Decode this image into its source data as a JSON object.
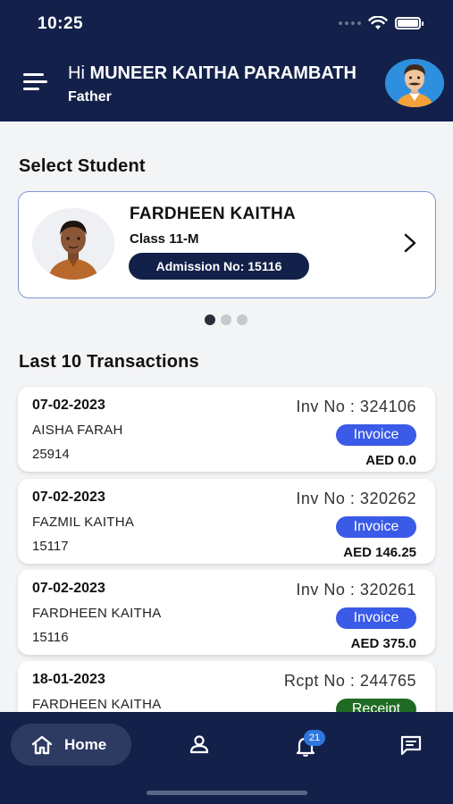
{
  "status_bar": {
    "time": "10:25"
  },
  "header": {
    "greeting_prefix": "Hi",
    "parent_name": "MUNEER KAITHA PARAMBATH",
    "role": "Father"
  },
  "select_student": {
    "title": "Select Student",
    "student": {
      "name": "FARDHEEN KAITHA",
      "class": "Class 11-M",
      "admission": "Admission No: 15116"
    },
    "pager": {
      "count": 3,
      "active": 0
    }
  },
  "transactions": {
    "title": "Last 10 Transactions",
    "items": [
      {
        "date": "07-02-2023",
        "name": "AISHA FARAH",
        "id": "25914",
        "ref": "Inv No : 324106",
        "type": "Invoice",
        "amount": "AED 0.0"
      },
      {
        "date": "07-02-2023",
        "name": "FAZMIL KAITHA",
        "id": "15117",
        "ref": "Inv No : 320262",
        "type": "Invoice",
        "amount": "AED 146.25"
      },
      {
        "date": "07-02-2023",
        "name": "FARDHEEN KAITHA",
        "id": "15116",
        "ref": "Inv No : 320261",
        "type": "Invoice",
        "amount": "AED 375.0"
      },
      {
        "date": "18-01-2023",
        "name": "FARDHEEN KAITHA",
        "id": "",
        "ref": "Rcpt No : 244765",
        "type": "Receipt",
        "amount": ""
      }
    ]
  },
  "bottom_nav": {
    "home_label": "Home",
    "notification_count": "21",
    "icons": [
      "home-icon",
      "profile-icon",
      "bell-icon",
      "chat-icon"
    ]
  },
  "colors": {
    "primary": "#13214a",
    "invoice": "#3a5ae8",
    "receipt": "#1f6b23",
    "badge": "#2f77e0"
  }
}
